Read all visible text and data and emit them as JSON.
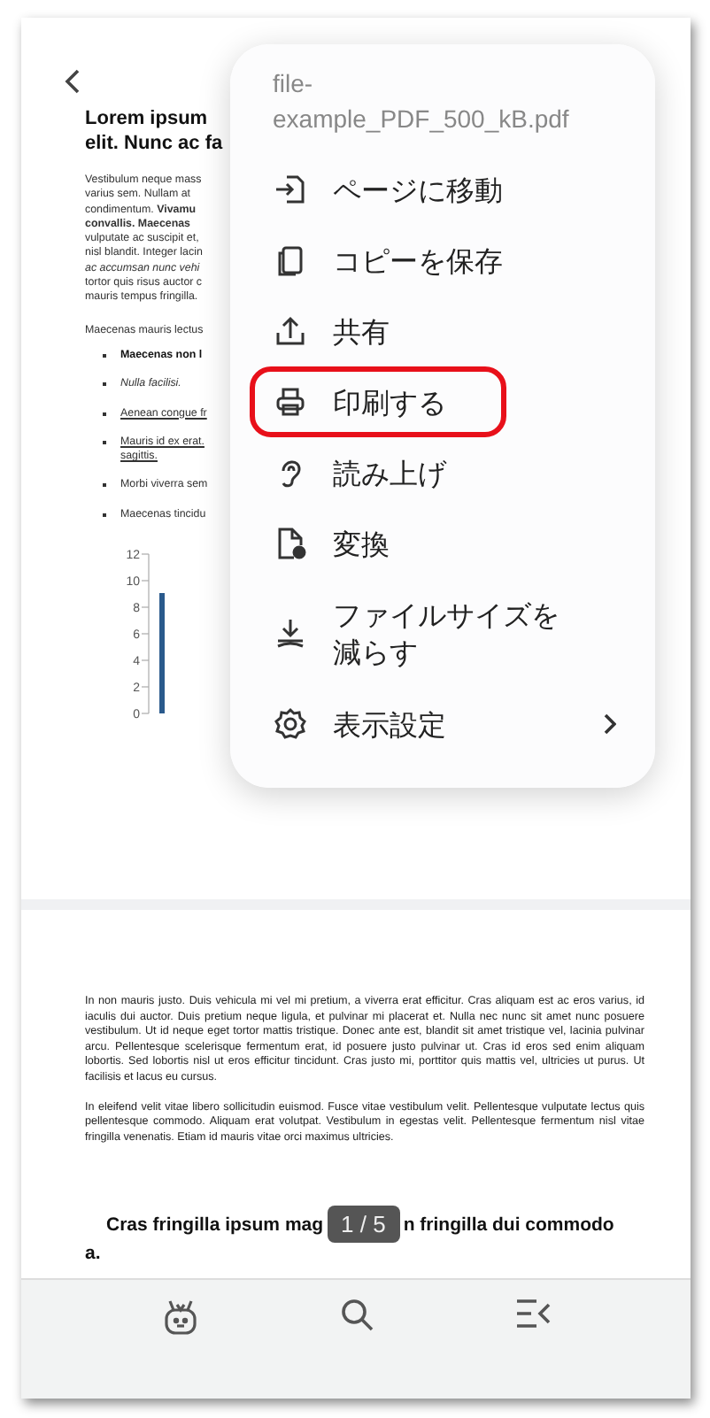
{
  "page_1": {
    "heading_lines": [
      "Lorem ipsum",
      "elit. Nunc ac fa"
    ],
    "paragraph_lines": [
      "Vestibulum neque mass",
      "varius sem. Nullam at",
      "condimentum. **Vivamu**",
      "**convallis. Maecenas**",
      "vulputate ac suscipit et,",
      "nisl blandit. Integer lacin",
      "*ac accumsan nunc vehi*",
      "tortor quis risus auctor c",
      "mauris tempus fringilla."
    ],
    "paragraph_2": "Maecenas mauris lectus",
    "bullets": [
      {
        "kind": "bold",
        "lines": [
          "Maecenas non l"
        ]
      },
      {
        "kind": "italic",
        "lines": [
          "Nulla facilisi."
        ]
      },
      {
        "kind": "link",
        "lines": [
          "Aenean congue fr"
        ]
      },
      {
        "kind": "link-wrap",
        "lines": [
          "Mauris id ex erat.",
          "sagittis."
        ]
      },
      {
        "kind": "plain",
        "lines": [
          "Morbi viverra sem"
        ]
      },
      {
        "kind": "plain",
        "lines": [
          "Maecenas tincidu"
        ]
      }
    ],
    "chart_axis_labels": [
      "12",
      "10",
      "8",
      "6",
      "4",
      "2",
      "0"
    ]
  },
  "page_2": {
    "paragraphs": [
      "In non mauris justo. Duis vehicula mi vel mi pretium, a viverra erat efficitur. Cras aliquam est ac eros varius, id iaculis dui auctor. Duis pretium neque ligula, et pulvinar mi placerat et. Nulla nec nunc sit amet nunc posuere vestibulum. Ut id neque eget tortor mattis tristique. Donec ante est, blandit sit amet tristique vel, lacinia pulvinar arcu. Pellentesque scelerisque fermentum erat, id posuere justo pulvinar ut. Cras id eros sed enim aliquam lobortis. Sed lobortis nisl ut eros efficitur tincidunt. Cras justo mi, porttitor quis mattis vel, ultricies ut purus. Ut facilisis et lacus eu cursus.",
      "In eleifend velit vitae libero sollicitudin euismod. Fusce vitae vestibulum velit. Pellentesque vulputate lectus quis pellentesque commodo. Aliquam erat volutpat. Vestibulum in egestas velit. Pellentesque fermentum nisl vitae fringilla venenatis. Etiam id mauris vitae orci maximus ultricies."
    ],
    "heading_before": "Cras fringilla ipsum mag",
    "heading_after": "n fringilla dui commodo",
    "heading_end": "a."
  },
  "page_indicator": "1 / 5",
  "menu": {
    "file_name": "file-example_PDF_500_kB.pdf",
    "items": [
      {
        "kind": "goto",
        "label": "ページに移動",
        "highlighted": false,
        "submenu": false
      },
      {
        "kind": "copy",
        "label": "コピーを保存",
        "highlighted": false,
        "submenu": false
      },
      {
        "kind": "share",
        "label": "共有",
        "highlighted": false,
        "submenu": false
      },
      {
        "kind": "print",
        "label": "印刷する",
        "highlighted": true,
        "submenu": false
      },
      {
        "kind": "read",
        "label": "読み上げ",
        "highlighted": false,
        "submenu": false
      },
      {
        "kind": "convert",
        "label": "変換",
        "highlighted": false,
        "submenu": false
      },
      {
        "kind": "reduce",
        "label": "ファイルサイズを減らす",
        "highlighted": false,
        "submenu": false
      },
      {
        "kind": "settings",
        "label": "表示設定",
        "highlighted": false,
        "submenu": true
      }
    ]
  }
}
